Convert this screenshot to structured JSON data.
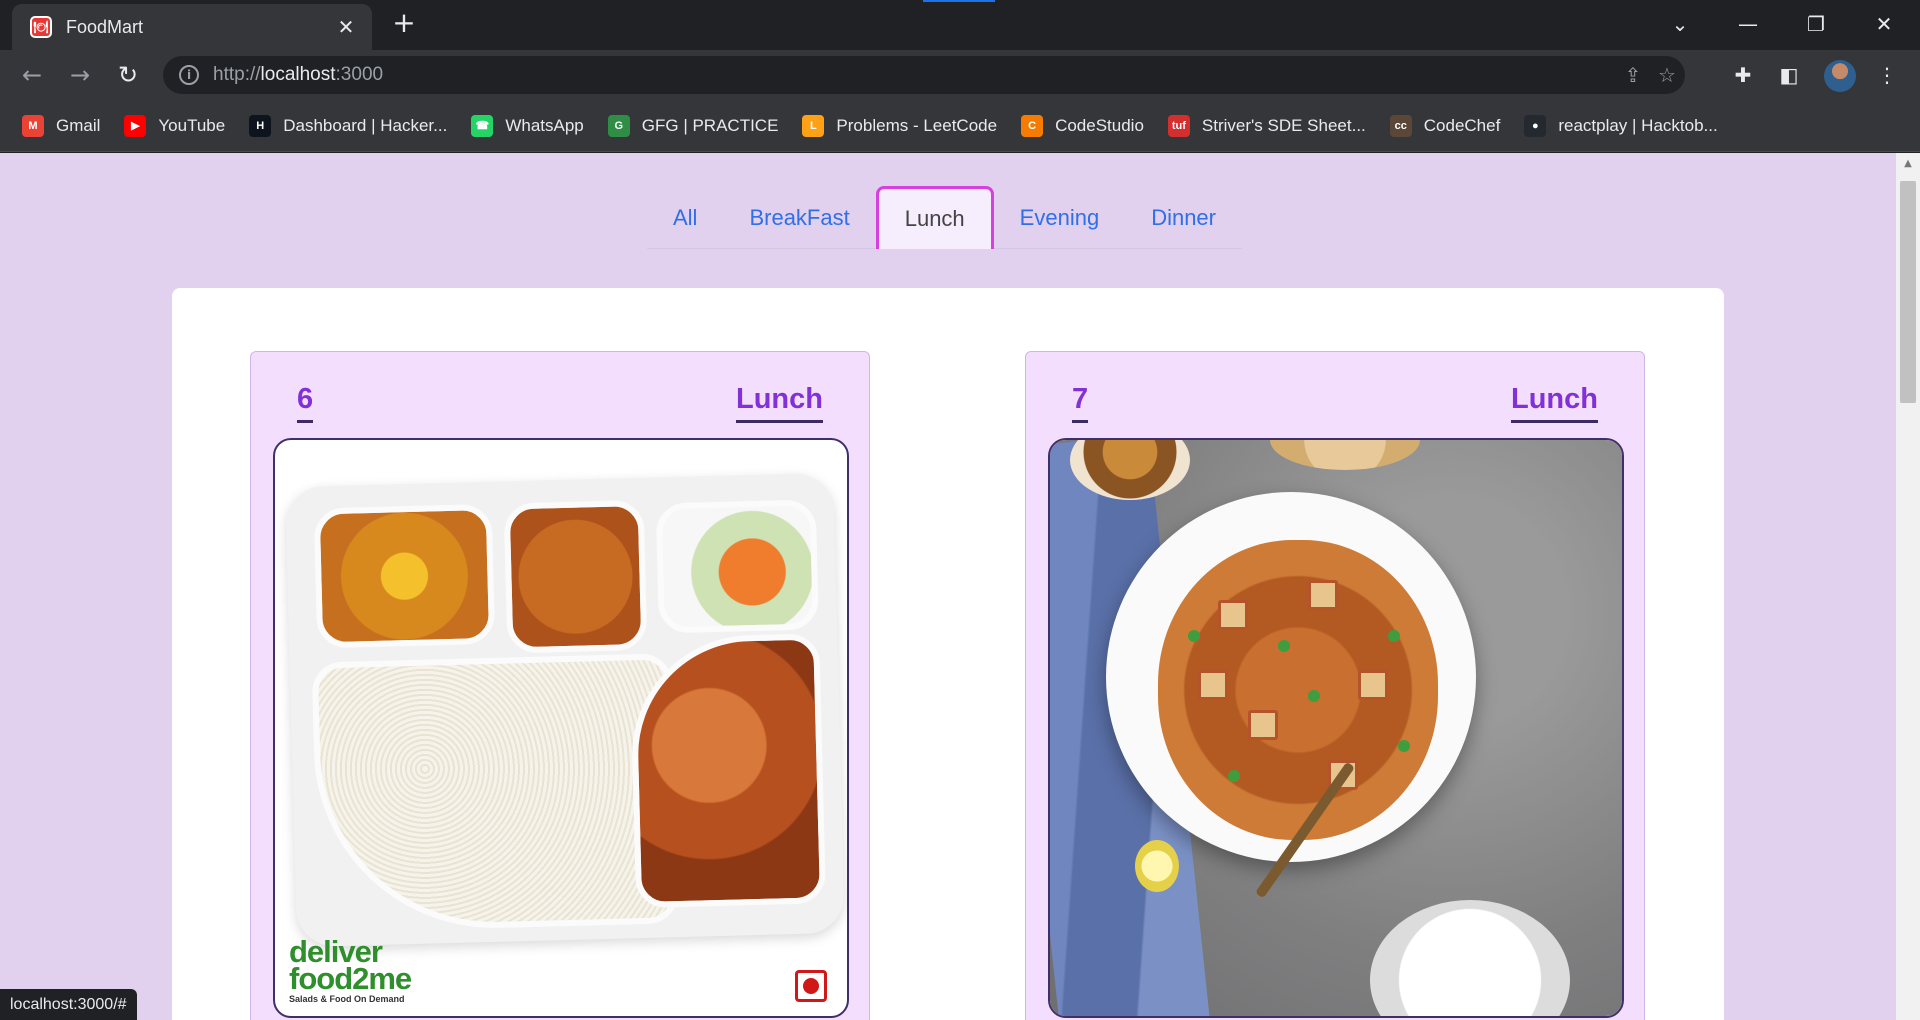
{
  "browser": {
    "tab_title": "FoodMart",
    "tab_favicon": "🍽",
    "url_scheme": "http://",
    "url_host": "localhost",
    "url_port": ":3000",
    "status_url": "localhost:3000/#",
    "bookmarks": [
      {
        "label": "Gmail",
        "icon": "gmail-icon",
        "color": "#ea4335",
        "glyph": "M"
      },
      {
        "label": "YouTube",
        "icon": "youtube-icon",
        "color": "#ff0000",
        "glyph": "▶"
      },
      {
        "label": "Dashboard | Hacker...",
        "icon": "hackerrank-icon",
        "color": "#0e141e",
        "glyph": "H"
      },
      {
        "label": "WhatsApp",
        "icon": "whatsapp-icon",
        "color": "#25d366",
        "glyph": "☎"
      },
      {
        "label": "GFG | PRACTICE",
        "icon": "gfg-icon",
        "color": "#2f8d46",
        "glyph": "G"
      },
      {
        "label": "Problems - LeetCode",
        "icon": "leetcode-icon",
        "color": "#ffa116",
        "glyph": "L"
      },
      {
        "label": "CodeStudio",
        "icon": "codestudio-icon",
        "color": "#f57c00",
        "glyph": "C"
      },
      {
        "label": "Striver's SDE Sheet...",
        "icon": "tuf-icon",
        "color": "#d32f2f",
        "glyph": "tuf"
      },
      {
        "label": "CodeChef",
        "icon": "codechef-icon",
        "color": "#5b4638",
        "glyph": "cc"
      },
      {
        "label": "reactplay | Hacktob...",
        "icon": "github-icon",
        "color": "#24292f",
        "glyph": "●"
      }
    ]
  },
  "filters": {
    "tabs": [
      "All",
      "BreakFast",
      "Lunch",
      "Evening",
      "Dinner"
    ],
    "active": "Lunch"
  },
  "cards": [
    {
      "id": "6",
      "category": "Lunch",
      "image": "meal-tray-image",
      "brand_line1": "deliver",
      "brand_line2": "food2me",
      "brand_line3": "Salads & Food On Demand"
    },
    {
      "id": "7",
      "category": "Lunch",
      "image": "paneer-biryani-image"
    }
  ],
  "colors": {
    "page_bg": "#e1d1ef",
    "card_bg": "#f3dffd",
    "accent_purple": "#8231d6",
    "tab_link": "#2f6fe8",
    "active_tab_border": "#d63fe0"
  }
}
